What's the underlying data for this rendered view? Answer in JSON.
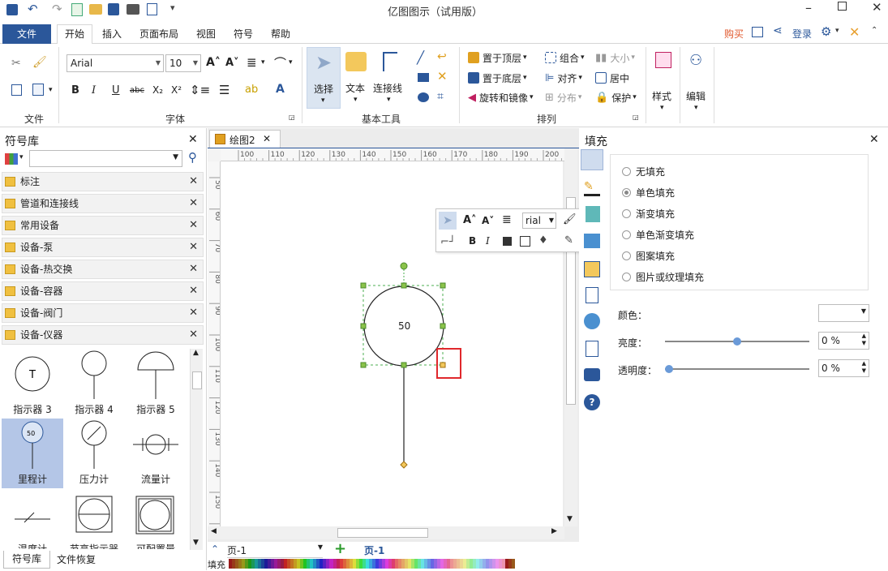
{
  "window": {
    "title": "亿图图示（试用版）"
  },
  "menu_tabs": [
    "文件",
    "开始",
    "插入",
    "页面布局",
    "视图",
    "符号",
    "帮助"
  ],
  "right_links": {
    "buy": "购买",
    "login": "登录"
  },
  "ribbon": {
    "font_name": "Arial",
    "font_size": "10",
    "groups": {
      "file": "文件",
      "font": "字体",
      "basic_tools": "基本工具",
      "arrange": "排列"
    },
    "tools": {
      "select": "选择",
      "text": "文本",
      "connector": "连接线"
    },
    "arrange": {
      "bring_front": "置于顶层",
      "send_back": "置于底层",
      "rotate": "旋转和镜像",
      "group": "组合",
      "align": "对齐",
      "distribute": "分布",
      "size": "大小",
      "center": "居中",
      "protect": "保护"
    },
    "style": "样式",
    "edit": "编辑"
  },
  "library": {
    "title": "符号库",
    "search_placeholder": "",
    "categories": [
      "标注",
      "管道和连接线",
      "常用设备",
      "设备-泵",
      "设备-热交换",
      "设备-容器",
      "设备-阀门",
      "设备-仪器"
    ],
    "symbols": [
      "指示器 3",
      "指示器 4",
      "指示器 5",
      "里程计",
      "压力计",
      "流量计",
      "温度计",
      "节高指示器",
      "可配置量"
    ],
    "bottom_tabs": [
      "符号库",
      "文件恢复"
    ]
  },
  "document": {
    "tab_name": "绘图2",
    "ruler_h": [
      "100",
      "110",
      "120",
      "130",
      "140",
      "150",
      "160",
      "170",
      "180",
      "190",
      "200"
    ],
    "ruler_v": [
      "50",
      "60",
      "70",
      "80",
      "90",
      "100",
      "110",
      "120",
      "130",
      "140",
      "150",
      "160"
    ],
    "shape_value": "50",
    "mini_font": "rial",
    "page_label": "页-1",
    "page_tab": "页-1",
    "fill_label": "填充"
  },
  "fill_panel": {
    "title": "填充",
    "options": [
      "无填充",
      "单色填充",
      "渐变填充",
      "单色渐变填充",
      "图案填充",
      "图片或纹理填充"
    ],
    "selected": "单色填充",
    "color_label": "颜色：",
    "brightness_label": "亮度：",
    "brightness_value": "0 %",
    "opacity_label": "透明度：",
    "opacity_value": "0 %"
  },
  "colors": {
    "accent": "#2b579a",
    "highlight": "#e0282c",
    "selected_symbol_bg": "#b4c6e7"
  }
}
